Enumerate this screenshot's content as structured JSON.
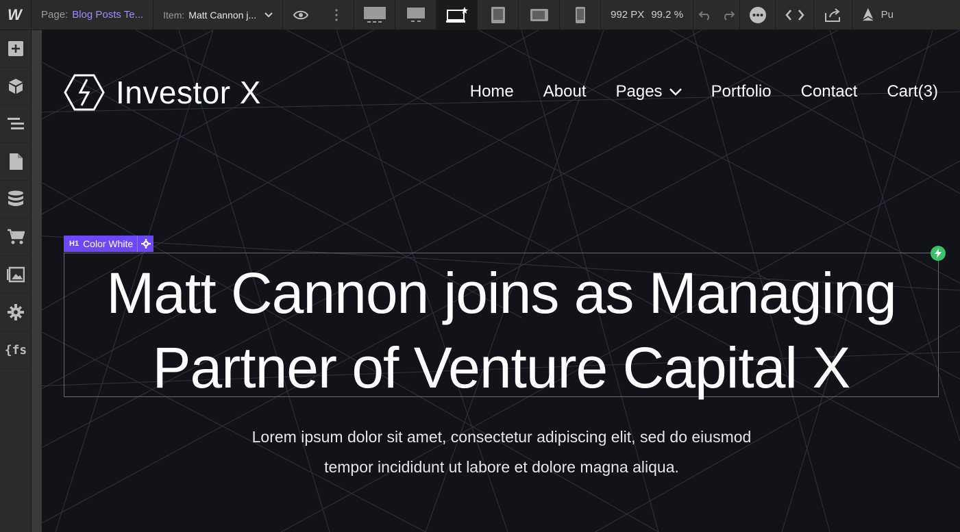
{
  "toolbar": {
    "page_label": "Page:",
    "page_value": "Blog Posts Te...",
    "item_label": "Item:",
    "item_value": "Matt Cannon j...",
    "width_readout": "992 PX",
    "zoom_readout": "99.2 %",
    "publish_partial": "Pu"
  },
  "sidebar": {
    "items": [
      "add-icon",
      "components-icon",
      "navigator-icon",
      "pages-icon",
      "cms-icon",
      "ecommerce-icon",
      "assets-icon",
      "settings-icon",
      "finsweet-icon"
    ],
    "fs_label": "{fs"
  },
  "site": {
    "brand": "Investor X",
    "nav": [
      "Home",
      "About",
      "Pages",
      "Portfolio",
      "Contact",
      "Cart(3)"
    ],
    "selection_tag": {
      "type": "H1",
      "label": "Color White"
    },
    "headline_line1": "Matt Cannon joins as Managing",
    "headline_line2": "Partner of Venture Capital X",
    "lead_line1": "Lorem ipsum dolor sit amet, consectetur adipiscing elit, sed do eiusmod",
    "lead_line2": "tempor incididunt ut labore et dolore magna aliqua."
  },
  "colors": {
    "canvas_bg": "#111319",
    "selection": "#6b47ff",
    "page_accent": "#9b8cff",
    "bolt": "#39c26b"
  }
}
